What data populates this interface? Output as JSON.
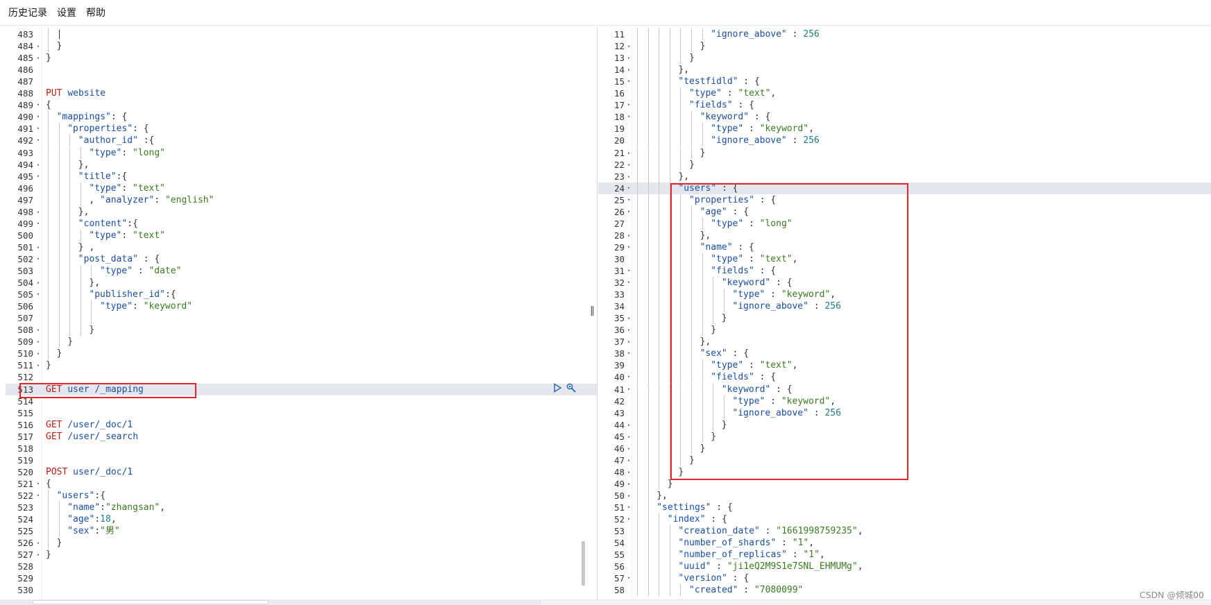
{
  "menu": [
    "历史记录",
    "设置",
    "帮助"
  ],
  "watermark": "CSDN @倾城00",
  "left_editor": [
    {
      "n": "483",
      "f": "",
      "i": 1,
      "t": [
        [
          "| ",
          "t-punc"
        ]
      ]
    },
    {
      "n": "484",
      "f": "▴",
      "i": 1,
      "t": [
        [
          "}",
          "t-punc"
        ]
      ]
    },
    {
      "n": "485",
      "f": "▴",
      "i": 0,
      "t": [
        [
          "}",
          "t-punc"
        ]
      ]
    },
    {
      "n": "486",
      "f": "",
      "i": 0,
      "t": []
    },
    {
      "n": "487",
      "f": "",
      "i": 0,
      "t": []
    },
    {
      "n": "488",
      "f": "",
      "i": 0,
      "t": [
        [
          "PUT ",
          "t-method"
        ],
        [
          "website",
          "t-path"
        ]
      ]
    },
    {
      "n": "489",
      "f": "▾",
      "i": 0,
      "t": [
        [
          "{",
          "t-punc"
        ]
      ]
    },
    {
      "n": "490",
      "f": "▾",
      "i": 1,
      "t": [
        [
          "\"mappings\"",
          "t-key"
        ],
        [
          ": {",
          "t-punc"
        ]
      ]
    },
    {
      "n": "491",
      "f": "▾",
      "i": 2,
      "t": [
        [
          "\"properties\"",
          "t-key"
        ],
        [
          ": {",
          "t-punc"
        ]
      ]
    },
    {
      "n": "492",
      "f": "▾",
      "i": 3,
      "t": [
        [
          "\"author_id\"",
          "t-key"
        ],
        [
          " :{",
          "t-punc"
        ]
      ]
    },
    {
      "n": "493",
      "f": "",
      "i": 4,
      "t": [
        [
          "\"type\"",
          "t-key"
        ],
        [
          ": ",
          "t-punc"
        ],
        [
          "\"long\"",
          "t-str"
        ]
      ]
    },
    {
      "n": "494",
      "f": "▴",
      "i": 3,
      "t": [
        [
          "},",
          "t-punc"
        ]
      ]
    },
    {
      "n": "495",
      "f": "▾",
      "i": 3,
      "t": [
        [
          "\"title\"",
          "t-key"
        ],
        [
          ":{",
          "t-punc"
        ]
      ]
    },
    {
      "n": "496",
      "f": "",
      "i": 4,
      "t": [
        [
          "\"type\"",
          "t-key"
        ],
        [
          ": ",
          "t-punc"
        ],
        [
          "\"text\"",
          "t-str"
        ]
      ]
    },
    {
      "n": "497",
      "f": "",
      "i": 4,
      "t": [
        [
          ", ",
          "t-punc"
        ],
        [
          "\"analyzer\"",
          "t-key"
        ],
        [
          ": ",
          "t-punc"
        ],
        [
          "\"english\"",
          "t-str"
        ]
      ]
    },
    {
      "n": "498",
      "f": "▴",
      "i": 3,
      "t": [
        [
          "},",
          "t-punc"
        ]
      ]
    },
    {
      "n": "499",
      "f": "▾",
      "i": 3,
      "t": [
        [
          "\"content\"",
          "t-key"
        ],
        [
          ":{",
          "t-punc"
        ]
      ]
    },
    {
      "n": "500",
      "f": "",
      "i": 4,
      "t": [
        [
          "\"type\"",
          "t-key"
        ],
        [
          ": ",
          "t-punc"
        ],
        [
          "\"text\"",
          "t-str"
        ]
      ]
    },
    {
      "n": "501",
      "f": "▴",
      "i": 3,
      "t": [
        [
          "} ,",
          "t-punc"
        ]
      ]
    },
    {
      "n": "502",
      "f": "▾",
      "i": 3,
      "t": [
        [
          "\"post_data\"",
          "t-key"
        ],
        [
          " : {",
          "t-punc"
        ]
      ]
    },
    {
      "n": "503",
      "f": "",
      "i": 5,
      "t": [
        [
          "\"type\"",
          "t-key"
        ],
        [
          " : ",
          "t-punc"
        ],
        [
          "\"date\"",
          "t-str"
        ]
      ]
    },
    {
      "n": "504",
      "f": "▴",
      "i": 4,
      "t": [
        [
          "},",
          "t-punc"
        ]
      ]
    },
    {
      "n": "505",
      "f": "▾",
      "i": 4,
      "t": [
        [
          "\"publisher_id\"",
          "t-key"
        ],
        [
          ":{",
          "t-punc"
        ]
      ]
    },
    {
      "n": "506",
      "f": "",
      "i": 5,
      "t": [
        [
          "\"type\"",
          "t-key"
        ],
        [
          ": ",
          "t-punc"
        ],
        [
          "\"keyword\"",
          "t-str"
        ]
      ]
    },
    {
      "n": "507",
      "f": "",
      "i": 5,
      "t": []
    },
    {
      "n": "508",
      "f": "▴",
      "i": 4,
      "t": [
        [
          "}",
          "t-punc"
        ]
      ]
    },
    {
      "n": "509",
      "f": "▴",
      "i": 2,
      "t": [
        [
          "}",
          "t-punc"
        ]
      ]
    },
    {
      "n": "510",
      "f": "▴",
      "i": 1,
      "t": [
        [
          "}",
          "t-punc"
        ]
      ]
    },
    {
      "n": "511",
      "f": "▴",
      "i": 0,
      "t": [
        [
          "}",
          "t-punc"
        ]
      ]
    },
    {
      "n": "512",
      "f": "",
      "i": 0,
      "t": []
    },
    {
      "n": "513",
      "f": "",
      "i": 0,
      "active": true,
      "t": [
        [
          "GET ",
          "t-method"
        ],
        [
          "user /_mapping",
          "t-path"
        ]
      ]
    },
    {
      "n": "514",
      "f": "",
      "i": 0,
      "t": []
    },
    {
      "n": "515",
      "f": "",
      "i": 0,
      "t": []
    },
    {
      "n": "516",
      "f": "",
      "i": 0,
      "t": [
        [
          "GET ",
          "t-method"
        ],
        [
          "/user/_doc/1",
          "t-path"
        ]
      ]
    },
    {
      "n": "517",
      "f": "",
      "i": 0,
      "t": [
        [
          "GET ",
          "t-method"
        ],
        [
          "/user/_search",
          "t-path"
        ]
      ]
    },
    {
      "n": "518",
      "f": "",
      "i": 0,
      "t": []
    },
    {
      "n": "519",
      "f": "",
      "i": 0,
      "t": []
    },
    {
      "n": "520",
      "f": "",
      "i": 0,
      "t": [
        [
          "POST ",
          "t-method"
        ],
        [
          "user/_doc/1",
          "t-path"
        ]
      ]
    },
    {
      "n": "521",
      "f": "▾",
      "i": 0,
      "t": [
        [
          "{",
          "t-punc"
        ]
      ]
    },
    {
      "n": "522",
      "f": "▾",
      "i": 1,
      "t": [
        [
          "\"users\"",
          "t-key"
        ],
        [
          ":{",
          "t-punc"
        ]
      ]
    },
    {
      "n": "523",
      "f": "",
      "i": 2,
      "t": [
        [
          "\"name\"",
          "t-key"
        ],
        [
          ":",
          "t-punc"
        ],
        [
          "\"zhangsan\"",
          "t-str"
        ],
        [
          ",",
          "t-punc"
        ]
      ]
    },
    {
      "n": "524",
      "f": "",
      "i": 2,
      "t": [
        [
          "\"age\"",
          "t-key"
        ],
        [
          ":",
          "t-punc"
        ],
        [
          "18",
          "t-num"
        ],
        [
          ",",
          "t-punc"
        ]
      ]
    },
    {
      "n": "525",
      "f": "",
      "i": 2,
      "t": [
        [
          "\"sex\"",
          "t-key"
        ],
        [
          ":",
          "t-punc"
        ],
        [
          "\"男\"",
          "t-str"
        ]
      ]
    },
    {
      "n": "526",
      "f": "▴",
      "i": 1,
      "t": [
        [
          "}",
          "t-punc"
        ]
      ]
    },
    {
      "n": "527",
      "f": "▴",
      "i": 0,
      "t": [
        [
          "}",
          "t-punc"
        ]
      ]
    },
    {
      "n": "528",
      "f": "",
      "i": 0,
      "t": []
    },
    {
      "n": "529",
      "f": "",
      "i": 0,
      "t": []
    },
    {
      "n": "530",
      "f": "",
      "i": 0,
      "t": []
    }
  ],
  "right_editor": [
    {
      "n": "11",
      "f": "",
      "i": 7,
      "t": [
        [
          "\"ignore_above\"",
          "t-key"
        ],
        [
          " : ",
          "t-punc"
        ],
        [
          "256",
          "t-num"
        ]
      ]
    },
    {
      "n": "12",
      "f": "▴",
      "i": 6,
      "t": [
        [
          "}",
          "t-punc"
        ]
      ]
    },
    {
      "n": "13",
      "f": "▴",
      "i": 5,
      "t": [
        [
          "}",
          "t-punc"
        ]
      ]
    },
    {
      "n": "14",
      "f": "▴",
      "i": 4,
      "t": [
        [
          "},",
          "t-punc"
        ]
      ]
    },
    {
      "n": "15",
      "f": "▾",
      "i": 4,
      "t": [
        [
          "\"testfidld\"",
          "t-key"
        ],
        [
          " : {",
          "t-punc"
        ]
      ]
    },
    {
      "n": "16",
      "f": "",
      "i": 5,
      "t": [
        [
          "\"type\"",
          "t-key"
        ],
        [
          " : ",
          "t-punc"
        ],
        [
          "\"text\"",
          "t-str"
        ],
        [
          ",",
          "t-punc"
        ]
      ]
    },
    {
      "n": "17",
      "f": "▾",
      "i": 5,
      "t": [
        [
          "\"fields\"",
          "t-key"
        ],
        [
          " : {",
          "t-punc"
        ]
      ]
    },
    {
      "n": "18",
      "f": "▾",
      "i": 6,
      "t": [
        [
          "\"keyword\"",
          "t-key"
        ],
        [
          " : {",
          "t-punc"
        ]
      ]
    },
    {
      "n": "19",
      "f": "",
      "i": 7,
      "t": [
        [
          "\"type\"",
          "t-key"
        ],
        [
          " : ",
          "t-punc"
        ],
        [
          "\"keyword\"",
          "t-str"
        ],
        [
          ",",
          "t-punc"
        ]
      ]
    },
    {
      "n": "20",
      "f": "",
      "i": 7,
      "t": [
        [
          "\"ignore_above\"",
          "t-key"
        ],
        [
          " : ",
          "t-punc"
        ],
        [
          "256",
          "t-num"
        ]
      ]
    },
    {
      "n": "21",
      "f": "▴",
      "i": 6,
      "t": [
        [
          "}",
          "t-punc"
        ]
      ]
    },
    {
      "n": "22",
      "f": "▴",
      "i": 5,
      "t": [
        [
          "}",
          "t-punc"
        ]
      ]
    },
    {
      "n": "23",
      "f": "▴",
      "i": 4,
      "t": [
        [
          "},",
          "t-punc"
        ]
      ]
    },
    {
      "n": "24",
      "f": "▾",
      "i": 4,
      "active": true,
      "t": [
        [
          "\"users\"",
          "t-key"
        ],
        [
          " : {",
          "t-punc"
        ]
      ]
    },
    {
      "n": "25",
      "f": "▾",
      "i": 5,
      "t": [
        [
          "\"properties\"",
          "t-key"
        ],
        [
          " : {",
          "t-punc"
        ]
      ]
    },
    {
      "n": "26",
      "f": "▾",
      "i": 6,
      "t": [
        [
          "\"age\"",
          "t-key"
        ],
        [
          " : {",
          "t-punc"
        ]
      ]
    },
    {
      "n": "27",
      "f": "",
      "i": 7,
      "t": [
        [
          "\"type\"",
          "t-key"
        ],
        [
          " : ",
          "t-punc"
        ],
        [
          "\"long\"",
          "t-str"
        ]
      ]
    },
    {
      "n": "28",
      "f": "▴",
      "i": 6,
      "t": [
        [
          "},",
          "t-punc"
        ]
      ]
    },
    {
      "n": "29",
      "f": "▾",
      "i": 6,
      "t": [
        [
          "\"name\"",
          "t-key"
        ],
        [
          " : {",
          "t-punc"
        ]
      ]
    },
    {
      "n": "30",
      "f": "",
      "i": 7,
      "t": [
        [
          "\"type\"",
          "t-key"
        ],
        [
          " : ",
          "t-punc"
        ],
        [
          "\"text\"",
          "t-str"
        ],
        [
          ",",
          "t-punc"
        ]
      ]
    },
    {
      "n": "31",
      "f": "▾",
      "i": 7,
      "t": [
        [
          "\"fields\"",
          "t-key"
        ],
        [
          " : {",
          "t-punc"
        ]
      ]
    },
    {
      "n": "32",
      "f": "▾",
      "i": 8,
      "t": [
        [
          "\"keyword\"",
          "t-key"
        ],
        [
          " : {",
          "t-punc"
        ]
      ]
    },
    {
      "n": "33",
      "f": "",
      "i": 9,
      "t": [
        [
          "\"type\"",
          "t-key"
        ],
        [
          " : ",
          "t-punc"
        ],
        [
          "\"keyword\"",
          "t-str"
        ],
        [
          ",",
          "t-punc"
        ]
      ]
    },
    {
      "n": "34",
      "f": "",
      "i": 9,
      "t": [
        [
          "\"ignore_above\"",
          "t-key"
        ],
        [
          " : ",
          "t-punc"
        ],
        [
          "256",
          "t-num"
        ]
      ]
    },
    {
      "n": "35",
      "f": "▴",
      "i": 8,
      "t": [
        [
          "}",
          "t-punc"
        ]
      ]
    },
    {
      "n": "36",
      "f": "▴",
      "i": 7,
      "t": [
        [
          "}",
          "t-punc"
        ]
      ]
    },
    {
      "n": "37",
      "f": "▴",
      "i": 6,
      "t": [
        [
          "},",
          "t-punc"
        ]
      ]
    },
    {
      "n": "38",
      "f": "▾",
      "i": 6,
      "t": [
        [
          "\"sex\"",
          "t-key"
        ],
        [
          " : {",
          "t-punc"
        ]
      ]
    },
    {
      "n": "39",
      "f": "",
      "i": 7,
      "t": [
        [
          "\"type\"",
          "t-key"
        ],
        [
          " : ",
          "t-punc"
        ],
        [
          "\"text\"",
          "t-str"
        ],
        [
          ",",
          "t-punc"
        ]
      ]
    },
    {
      "n": "40",
      "f": "▾",
      "i": 7,
      "t": [
        [
          "\"fields\"",
          "t-key"
        ],
        [
          " : {",
          "t-punc"
        ]
      ]
    },
    {
      "n": "41",
      "f": "▾",
      "i": 8,
      "t": [
        [
          "\"keyword\"",
          "t-key"
        ],
        [
          " : {",
          "t-punc"
        ]
      ]
    },
    {
      "n": "42",
      "f": "",
      "i": 9,
      "t": [
        [
          "\"type\"",
          "t-key"
        ],
        [
          " : ",
          "t-punc"
        ],
        [
          "\"keyword\"",
          "t-str"
        ],
        [
          ",",
          "t-punc"
        ]
      ]
    },
    {
      "n": "43",
      "f": "",
      "i": 9,
      "t": [
        [
          "\"ignore_above\"",
          "t-key"
        ],
        [
          " : ",
          "t-punc"
        ],
        [
          "256",
          "t-num"
        ]
      ]
    },
    {
      "n": "44",
      "f": "▴",
      "i": 8,
      "t": [
        [
          "}",
          "t-punc"
        ]
      ]
    },
    {
      "n": "45",
      "f": "▴",
      "i": 7,
      "t": [
        [
          "}",
          "t-punc"
        ]
      ]
    },
    {
      "n": "46",
      "f": "▴",
      "i": 6,
      "t": [
        [
          "}",
          "t-punc"
        ]
      ]
    },
    {
      "n": "47",
      "f": "▴",
      "i": 5,
      "t": [
        [
          "}",
          "t-punc"
        ]
      ]
    },
    {
      "n": "48",
      "f": "▴",
      "i": 4,
      "t": [
        [
          "}",
          "t-punc"
        ]
      ]
    },
    {
      "n": "49",
      "f": "▴",
      "i": 3,
      "t": [
        [
          "}",
          "t-punc"
        ]
      ]
    },
    {
      "n": "50",
      "f": "▴",
      "i": 2,
      "t": [
        [
          "},",
          "t-punc"
        ]
      ]
    },
    {
      "n": "51",
      "f": "▾",
      "i": 2,
      "t": [
        [
          "\"settings\"",
          "t-key"
        ],
        [
          " : {",
          "t-punc"
        ]
      ]
    },
    {
      "n": "52",
      "f": "▾",
      "i": 3,
      "t": [
        [
          "\"index\"",
          "t-key"
        ],
        [
          " : {",
          "t-punc"
        ]
      ]
    },
    {
      "n": "53",
      "f": "",
      "i": 4,
      "t": [
        [
          "\"creation_date\"",
          "t-key"
        ],
        [
          " : ",
          "t-punc"
        ],
        [
          "\"1661998759235\"",
          "t-str"
        ],
        [
          ",",
          "t-punc"
        ]
      ]
    },
    {
      "n": "54",
      "f": "",
      "i": 4,
      "t": [
        [
          "\"number_of_shards\"",
          "t-key"
        ],
        [
          " : ",
          "t-punc"
        ],
        [
          "\"1\"",
          "t-str"
        ],
        [
          ",",
          "t-punc"
        ]
      ]
    },
    {
      "n": "55",
      "f": "",
      "i": 4,
      "t": [
        [
          "\"number_of_replicas\"",
          "t-key"
        ],
        [
          " : ",
          "t-punc"
        ],
        [
          "\"1\"",
          "t-str"
        ],
        [
          ",",
          "t-punc"
        ]
      ]
    },
    {
      "n": "56",
      "f": "",
      "i": 4,
      "t": [
        [
          "\"uuid\"",
          "t-key"
        ],
        [
          " : ",
          "t-punc"
        ],
        [
          "\"ji1eQ2M9S1e7SNL_EHMUMg\"",
          "t-str"
        ],
        [
          ",",
          "t-punc"
        ]
      ]
    },
    {
      "n": "57",
      "f": "▾",
      "i": 4,
      "t": [
        [
          "\"version\"",
          "t-key"
        ],
        [
          " : {",
          "t-punc"
        ]
      ]
    },
    {
      "n": "58",
      "f": "",
      "i": 5,
      "t": [
        [
          "\"created\"",
          "t-key"
        ],
        [
          " : ",
          "t-punc"
        ],
        [
          "\"7080099\"",
          "t-str"
        ]
      ]
    }
  ]
}
